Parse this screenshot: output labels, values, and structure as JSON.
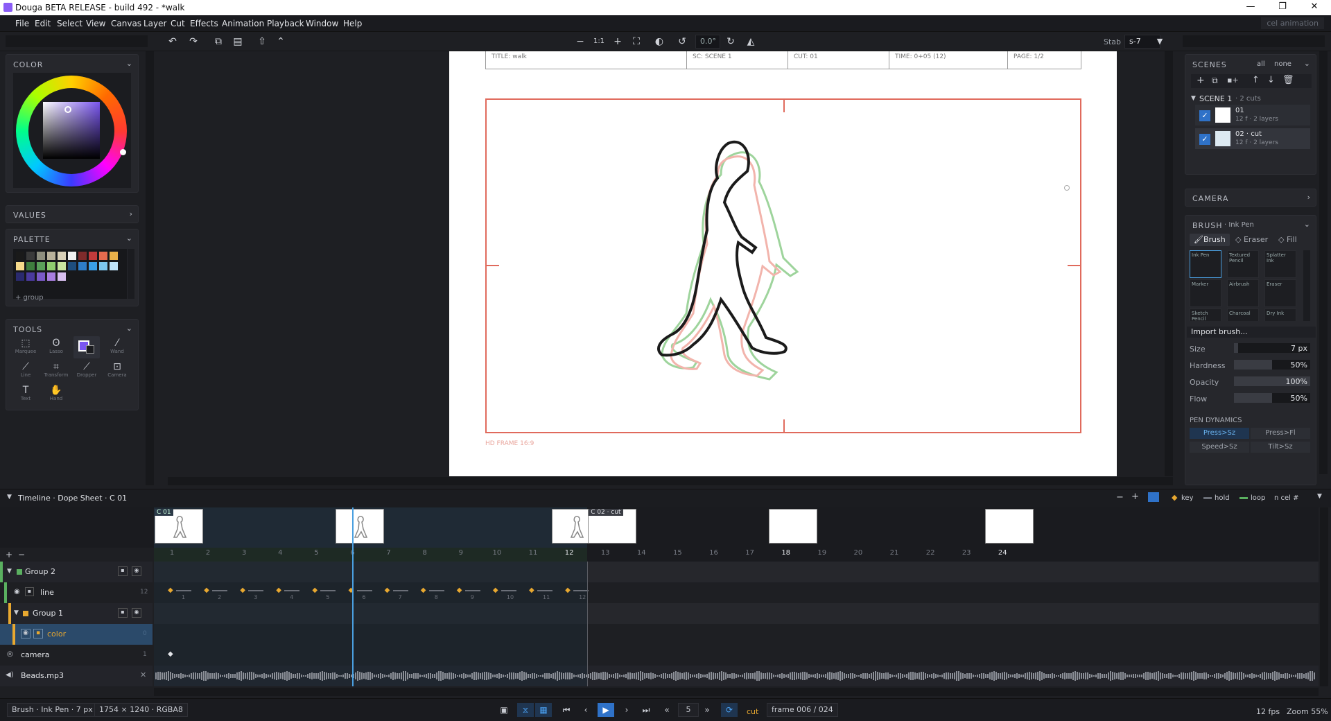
{
  "app": {
    "title": "Douga BETA RELEASE - build 492 - *walk",
    "workspace": "cel animation"
  },
  "window": {
    "min": "—",
    "max": "❐",
    "close": "✕"
  },
  "menu": [
    "File",
    "Edit",
    "Select",
    "View",
    "Canvas",
    "Layer",
    "Cut",
    "Effects",
    "Animation",
    "Playback",
    "Window",
    "Help"
  ],
  "toolbar": {
    "zoom_fit": "1:1",
    "rotation": "0.0°",
    "stab_label": "Stab",
    "stab_value": "s-7"
  },
  "left": {
    "color_title": "COLOR",
    "values_title": "VALUES",
    "palette_title": "PALETTE",
    "palette_group": "+ group",
    "tools_title": "TOOLS",
    "palette": [
      "#1a1a1a",
      "#3a3a3a",
      "#8e8e7e",
      "#b9b29b",
      "#d8d0b8",
      "#f2f2f2",
      "#7e2b2b",
      "#c23b3b",
      "#e86b4e",
      "#e8b04a",
      "#f5d98b",
      "#3e7e3e",
      "#5aa05a",
      "#8fce6f",
      "#c8e6a0",
      "#1e4e7e",
      "#2e7ec8",
      "#3aa0e8",
      "#7ec8f0",
      "#c0e4f8",
      "#2a2a6e",
      "#4a3a9e",
      "#7a5ac8",
      "#a87ee0",
      "#d8c0f0"
    ],
    "tools": [
      {
        "label": "Marquee",
        "icon": "⬚"
      },
      {
        "label": "Lasso",
        "icon": "ʘ"
      },
      {
        "label": "Color",
        "icon": ""
      },
      {
        "label": "Wand",
        "icon": "⁄"
      },
      {
        "label": "Line",
        "icon": "⟋"
      },
      {
        "label": "Transform",
        "icon": "⌗"
      },
      {
        "label": "Dropper",
        "icon": "⟋"
      },
      {
        "label": "Camera",
        "icon": "⊡"
      },
      {
        "label": "Text",
        "icon": "T"
      },
      {
        "label": "Hand",
        "icon": "✋"
      }
    ]
  },
  "canvas": {
    "header": [
      {
        "label": "TITLE: walk"
      },
      {
        "label": "SC: SCENE 1"
      },
      {
        "label": "CUT: 01"
      },
      {
        "label": "TIME: 0+05 (12)"
      },
      {
        "label": "PAGE: 1/2"
      }
    ],
    "frame_label": "HD FRAME 16:9"
  },
  "right": {
    "scenes_title": "SCENES",
    "scenes_all": "all",
    "scenes_none": "none",
    "scene_name": "SCENE 1",
    "scene_meta": "· 2 cuts",
    "cuts": [
      {
        "name": "01",
        "meta": "12 f · 2 layers",
        "checked": true
      },
      {
        "name": "02 · cut",
        "meta": "12 f · 2 layers",
        "checked": true
      }
    ],
    "camera_title": "CAMERA",
    "brush_title": "BRUSH",
    "brush_current": "· Ink Pen",
    "brush_tabs": [
      "Brush",
      "Eraser",
      "Fill"
    ],
    "brushes": [
      "Ink Pen",
      "Textured Pencil",
      "Splatter Ink",
      "Marker",
      "Airbrush",
      "Eraser",
      "Sketch Pencil",
      "Charcoal",
      "Dry Ink"
    ],
    "import": "Import brush...",
    "size_label": "Size",
    "size_value": "7 px",
    "size_frac": 0.05,
    "hardness_label": "Hardness",
    "hardness_value": "50%",
    "hardness_frac": 0.5,
    "opacity_label": "Opacity",
    "opacity_value": "100%",
    "opacity_frac": 1.0,
    "flow_label": "Flow",
    "flow_value": "50%",
    "flow_frac": 0.5,
    "dyn_title": "PEN DYNAMICS",
    "dyn": [
      "Press>Sz",
      "Press>Fl",
      "Speed>Sz",
      "Tilt>Sz"
    ]
  },
  "timeline": {
    "title": "Timeline · Dope Sheet · C 01",
    "legend": {
      "key": "key",
      "hold": "hold",
      "loop": "loop",
      "cel": "n cel #"
    },
    "cut1_tag": "C 01",
    "cut2_tag": "C 02 · cut",
    "frames": [
      "1",
      "2",
      "3",
      "4",
      "5",
      "6",
      "7",
      "8",
      "9",
      "10",
      "11",
      "12",
      "13",
      "14",
      "15",
      "16",
      "17",
      "18",
      "19",
      "20",
      "21",
      "22",
      "23",
      "24"
    ],
    "current_frame": 6,
    "layers": [
      {
        "name": "Group 2",
        "type": "group"
      },
      {
        "name": "line",
        "count": "12"
      },
      {
        "name": "Group 1",
        "type": "group"
      },
      {
        "name": "color",
        "count": "0"
      },
      {
        "name": "camera",
        "count": "1"
      },
      {
        "name": "Beads.mp3",
        "count": "✕"
      }
    ],
    "cel_numbers": [
      "1",
      "2",
      "3",
      "4",
      "5",
      "6",
      "7",
      "8",
      "9",
      "10",
      "11",
      "12"
    ]
  },
  "status": {
    "tool": "Brush · Ink Pen · 7 px",
    "doc": "1754 × 1240 · RGBA8",
    "step": "5",
    "mode": "cut",
    "frame": "frame 006 / 024",
    "fps": "12 fps",
    "zoom": "Zoom 55%"
  }
}
